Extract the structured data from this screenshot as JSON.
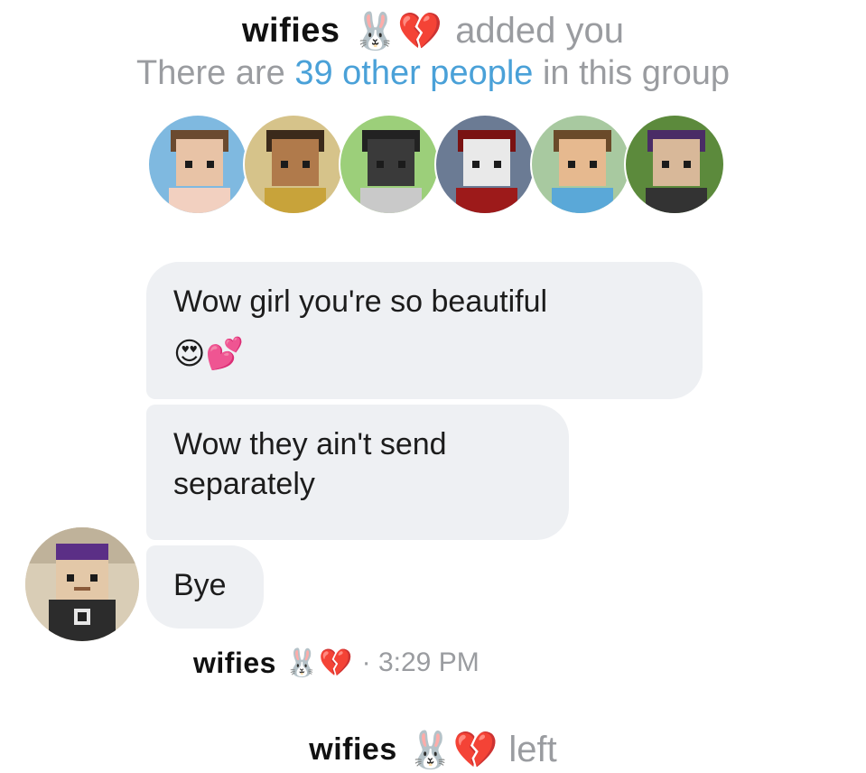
{
  "header": {
    "group_name": "wifies",
    "added_text": "added you",
    "info_prefix": "There are",
    "info_link": "39 other people",
    "info_suffix": "in this group"
  },
  "emojis": {
    "bunny": "🐰",
    "heart": "💔",
    "message_emojis": "😍💕"
  },
  "messages": [
    {
      "text": "Wow girl you're so beautiful"
    },
    {
      "text": "Wow they ain't send separately"
    },
    {
      "text": "Bye"
    }
  ],
  "footer": {
    "group_name": "wifies",
    "time": "· 3:29 PM"
  },
  "left_notice": {
    "group_name": "wifies",
    "text": "left"
  },
  "avatars": [
    {
      "name": "avatar-1",
      "hair": "#6b4a2f",
      "skin": "#e8c3a6",
      "body": "#f2d0c0",
      "bg": "#7fb9e0"
    },
    {
      "name": "avatar-2",
      "hair": "#3b2a1b",
      "skin": "#b07a4b",
      "body": "#c8a33a",
      "bg": "#d6c38a"
    },
    {
      "name": "avatar-3",
      "hair": "#222222",
      "skin": "#3a3a3a",
      "body": "#c9c9c9",
      "bg": "#9ccf7a"
    },
    {
      "name": "avatar-4",
      "hair": "#7a1212",
      "skin": "#e9e9e9",
      "body": "#9d1a1a",
      "bg": "#6b7b94"
    },
    {
      "name": "avatar-5",
      "hair": "#6a4a2a",
      "skin": "#e6b98f",
      "body": "#5aa8d8",
      "bg": "#a8c9a0"
    },
    {
      "name": "avatar-6",
      "hair": "#4a2c66",
      "skin": "#d8b899",
      "body": "#333333",
      "bg": "#5c8a3c"
    }
  ],
  "colors": {
    "bubble": "#eef0f3",
    "link": "#4aa1d8",
    "meta": "#9a9ca0"
  }
}
